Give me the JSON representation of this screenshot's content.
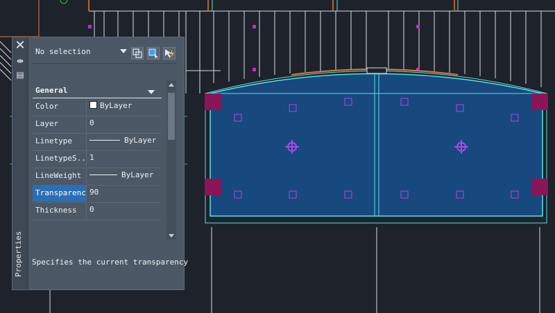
{
  "palette": {
    "title": "Properties",
    "selection": "No selection",
    "category": "General",
    "description": "Specifies the current transparency",
    "properties": [
      {
        "label": "Color",
        "value": "ByLayer",
        "kind": "color"
      },
      {
        "label": "Layer",
        "value": "0",
        "kind": "text"
      },
      {
        "label": "Linetype",
        "value": "ByLayer",
        "kind": "line"
      },
      {
        "label": "LinetypeS...",
        "value": "1",
        "kind": "text"
      },
      {
        "label": "LineWeight",
        "value": "ByLayer",
        "kind": "line"
      },
      {
        "label": "Transparency",
        "value": "90",
        "kind": "text",
        "selected": true
      },
      {
        "label": "Thickness",
        "value": "0",
        "kind": "text"
      }
    ]
  },
  "colors": {
    "background": "#1e222a",
    "panel": "#4d5866",
    "selected": "#2a6fb6",
    "fill": "#17487e",
    "cyan": "#56e3e6",
    "magenta": "#d81fd6",
    "orange": "#e07a3a"
  },
  "icons": {
    "close": "close-icon",
    "autohide": "autohide-icon",
    "menu": "properties-menu-icon",
    "toggle_pickadd": "toggle-pickadd-icon",
    "select_objects": "select-objects-icon",
    "quick_select": "quick-select-icon"
  }
}
